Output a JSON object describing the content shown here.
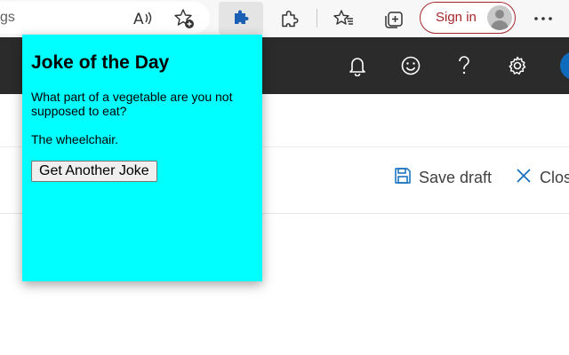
{
  "browser": {
    "address_text": "gs",
    "read_aloud_icon": "read-aloud-icon",
    "favorite_add_icon": "add-favorite-icon",
    "extensions_icon": "puzzle-icon",
    "extension_manage_icon": "extension-outline-icon",
    "favorites_icon": "favorites-icon",
    "collections_icon": "collections-icon",
    "signin_label": "Sign in",
    "more_icon": "ellipsis-icon"
  },
  "app_header": {
    "icons": [
      "bell-icon",
      "smiley-icon",
      "help-icon",
      "gear-icon"
    ]
  },
  "command_bar": {
    "save_draft_label": "Save draft",
    "close_label": "Clos"
  },
  "popup": {
    "title": "Joke of the Day",
    "setup": "What part of a vegetable are you not supposed to eat?",
    "punchline": "The wheelchair.",
    "button_label": "Get Another Joke",
    "background_color": "#00ffff"
  },
  "colors": {
    "signin_accent": "#a4262c",
    "app_header_bg": "#2b2b2b",
    "command_icon": "#0f6cbd",
    "extension_icon": "#1a5fb4"
  }
}
